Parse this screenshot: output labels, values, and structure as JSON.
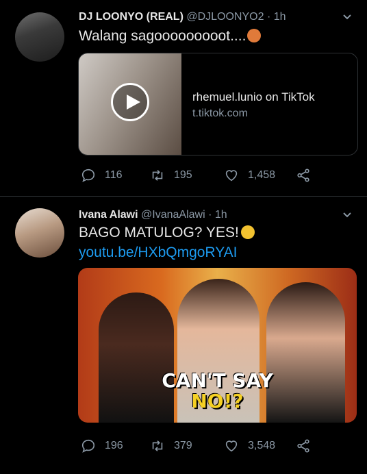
{
  "tweets": [
    {
      "name": "DJ LOONYO (REAL)",
      "handle": "@DJLOONYO2",
      "time": "· 1h",
      "text": "Walang sagooooooooot....",
      "card": {
        "title": "rhemuel.lunio on TikTok",
        "domain": "t.tiktok.com"
      },
      "stats": {
        "replies": "116",
        "retweets": "195",
        "likes": "1,458"
      }
    },
    {
      "name": "Ivana Alawi",
      "handle": "@IvanaAlawi",
      "time": "· 1h",
      "text": "BAGO MATULOG? YES!",
      "link": "youtu.be/HXbQmgoRYAI",
      "media": {
        "overlay_line1": "CAN'T SAY",
        "overlay_line2": "NO!?"
      },
      "stats": {
        "replies": "196",
        "retweets": "379",
        "likes": "3,548"
      }
    }
  ],
  "colors": {
    "background": "#000000",
    "link": "#1d9bf0",
    "muted": "#8b98a5",
    "divider": "#2f3336"
  }
}
